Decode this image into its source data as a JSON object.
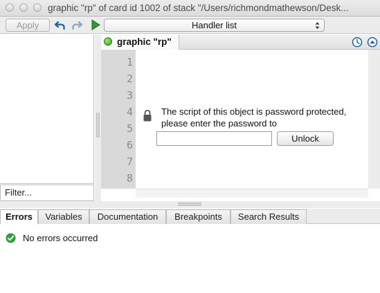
{
  "window": {
    "title": "graphic \"rp\" of card id 1002 of stack \"/Users/richmondmathewson/Desk..."
  },
  "toolbar": {
    "apply_label": "Apply",
    "handler_select_value": "Handler list"
  },
  "left_panel": {
    "filter_placeholder": "Filter..."
  },
  "editor": {
    "tab_label": "graphic \"rp\"",
    "line_numbers": [
      "1",
      "2",
      "3",
      "4",
      "5",
      "6",
      "7",
      "8"
    ],
    "password_message": "The script of this object is password protected, please enter the password to",
    "password_value": "",
    "unlock_label": "Unlock"
  },
  "bottom_tabs": [
    {
      "label": "Errors",
      "active": true
    },
    {
      "label": "Variables",
      "active": false
    },
    {
      "label": "Documentation",
      "active": false
    },
    {
      "label": "Breakpoints",
      "active": false
    },
    {
      "label": "Search Results",
      "active": false
    }
  ],
  "status": {
    "message": "No errors occurred",
    "icon": "check-circle-icon",
    "color": "#2e9e3a"
  },
  "colors": {
    "tab_indicator": "#3ea11c",
    "toolbar_icon": "#1d5fa8",
    "run_icon": "#2f9a2f"
  }
}
